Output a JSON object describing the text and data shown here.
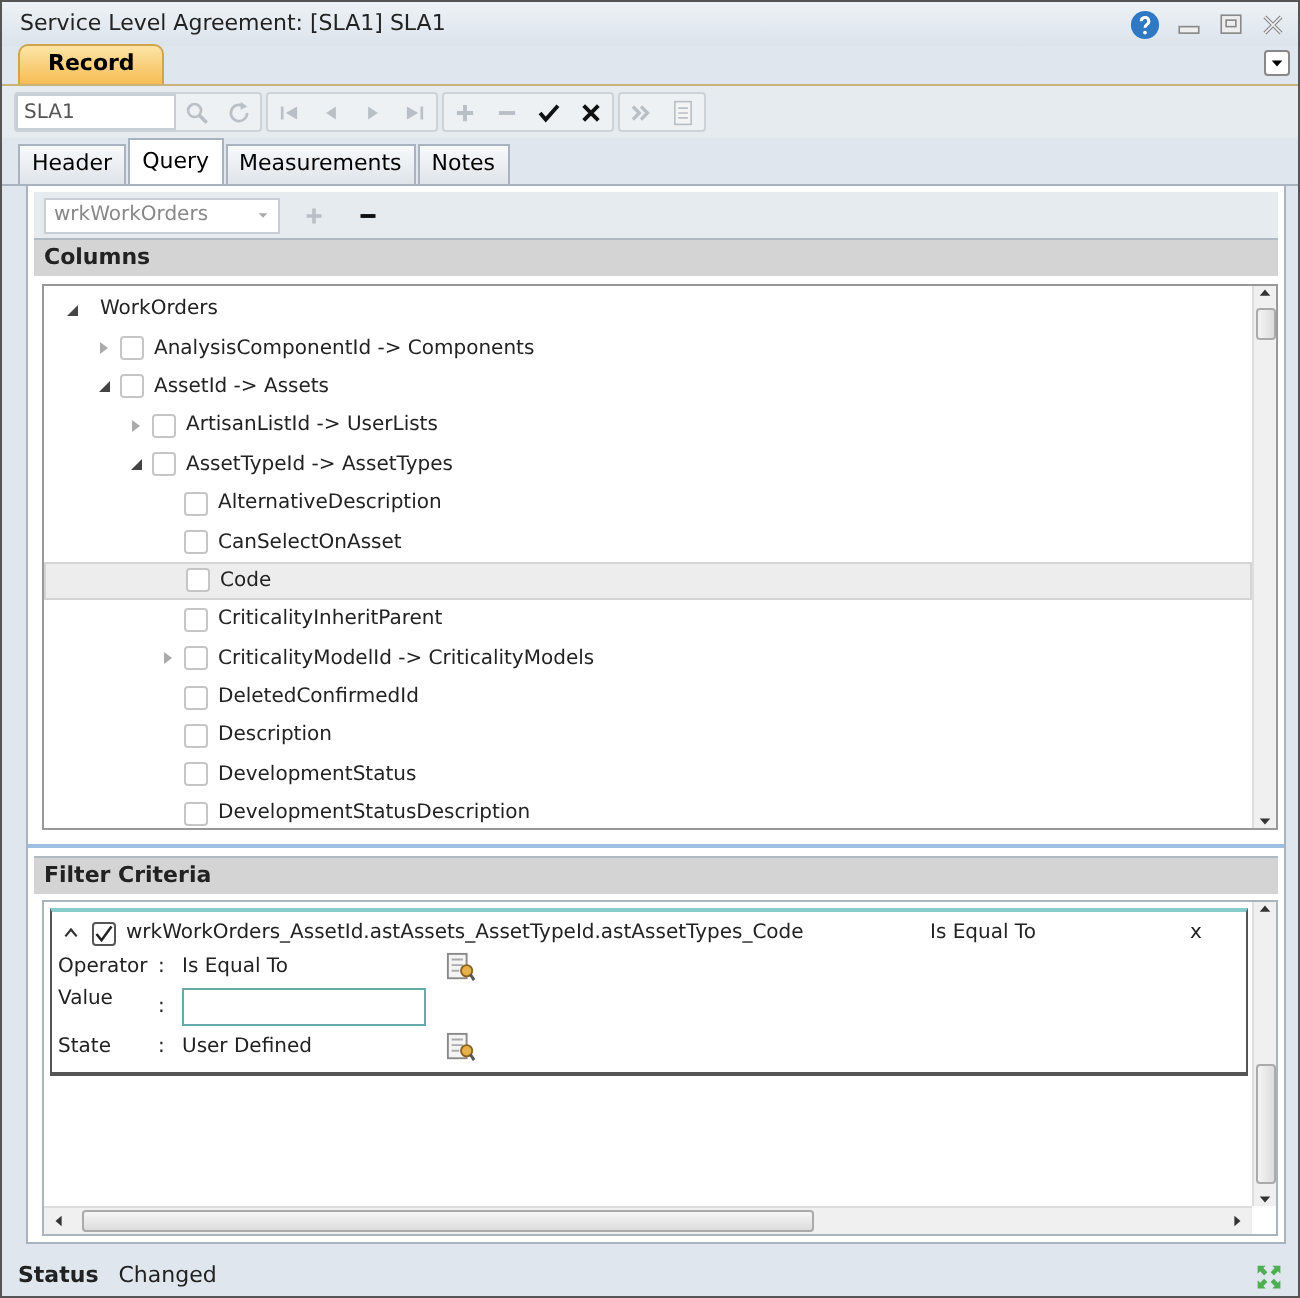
{
  "window": {
    "title": "Service Level Agreement: [SLA1] SLA1"
  },
  "ribbon_tabs": [
    {
      "label": "Record",
      "selected": true
    }
  ],
  "toolbar": {
    "record_field": "SLA1",
    "buttons": [
      {
        "disabled": true
      },
      {
        "disabled": true
      },
      {
        "disabled": true
      },
      {
        "disabled": true
      },
      {
        "disabled": true
      },
      {
        "disabled": true
      },
      {
        "disabled": true
      },
      {
        "disabled": true
      },
      {
        "disabled": false
      },
      {
        "disabled": false
      },
      {
        "disabled": true
      },
      {
        "disabled": true
      }
    ]
  },
  "tabs": [
    {
      "label": "Header",
      "selected": false
    },
    {
      "label": "Query",
      "selected": true
    },
    {
      "label": "Measurements",
      "selected": false
    },
    {
      "label": "Notes",
      "selected": false
    }
  ],
  "query": {
    "source_dropdown": "wrkWorkOrders",
    "buttons": [
      {
        "disabled": true
      },
      {
        "disabled": false
      }
    ]
  },
  "columns": {
    "title": "Columns",
    "tree": [
      {
        "label": "WorkOrders",
        "expanded": true,
        "selected": false,
        "children": [
          {
            "label": "AnalysisComponentId -> Components",
            "expanded": false,
            "checked": false,
            "selected": false
          },
          {
            "label": "AssetId -> Assets",
            "expanded": true,
            "checked": false,
            "selected": false,
            "children": [
              {
                "label": "ArtisanListId -> UserLists",
                "expanded": false,
                "checked": false,
                "selected": false
              },
              {
                "label": "AssetTypeId -> AssetTypes",
                "expanded": true,
                "checked": false,
                "selected": false,
                "children": [
                  {
                    "label": "AlternativeDescription",
                    "checked": false,
                    "selected": false
                  },
                  {
                    "label": "CanSelectOnAsset",
                    "checked": false,
                    "selected": false
                  },
                  {
                    "label": "Code",
                    "checked": false,
                    "selected": true
                  },
                  {
                    "label": "CriticalityInheritParent",
                    "checked": false,
                    "selected": false
                  },
                  {
                    "label": "CriticalityModelId -> CriticalityModels",
                    "expanded": false,
                    "checked": false,
                    "selected": false
                  },
                  {
                    "label": "DeletedConfirmedId",
                    "checked": false,
                    "selected": false
                  },
                  {
                    "label": "Description",
                    "checked": false,
                    "selected": false
                  },
                  {
                    "label": "DevelopmentStatus",
                    "checked": false,
                    "selected": false
                  },
                  {
                    "label": "DevelopmentStatusDescription",
                    "checked": false,
                    "selected": false
                  }
                ]
              }
            ]
          }
        ]
      }
    ]
  },
  "filter": {
    "title": "Filter Criteria",
    "criteria": [
      {
        "expanded": true,
        "checked": true,
        "field": "wrkWorkOrders_AssetId.astAssets_AssetTypeId.astAssetTypes_Code",
        "operator_summary": "Is Equal To",
        "remove": "x",
        "details": [
          {
            "label": "Operator",
            "separator": ":",
            "kind": "text",
            "value": "Is Equal To"
          },
          {
            "label": "Value",
            "separator": ":",
            "kind": "input"
          },
          {
            "label": "State",
            "separator": ":",
            "kind": "text",
            "value": "User Defined"
          }
        ]
      }
    ]
  },
  "status_bar": {
    "label": "Status",
    "value": "Changed"
  }
}
